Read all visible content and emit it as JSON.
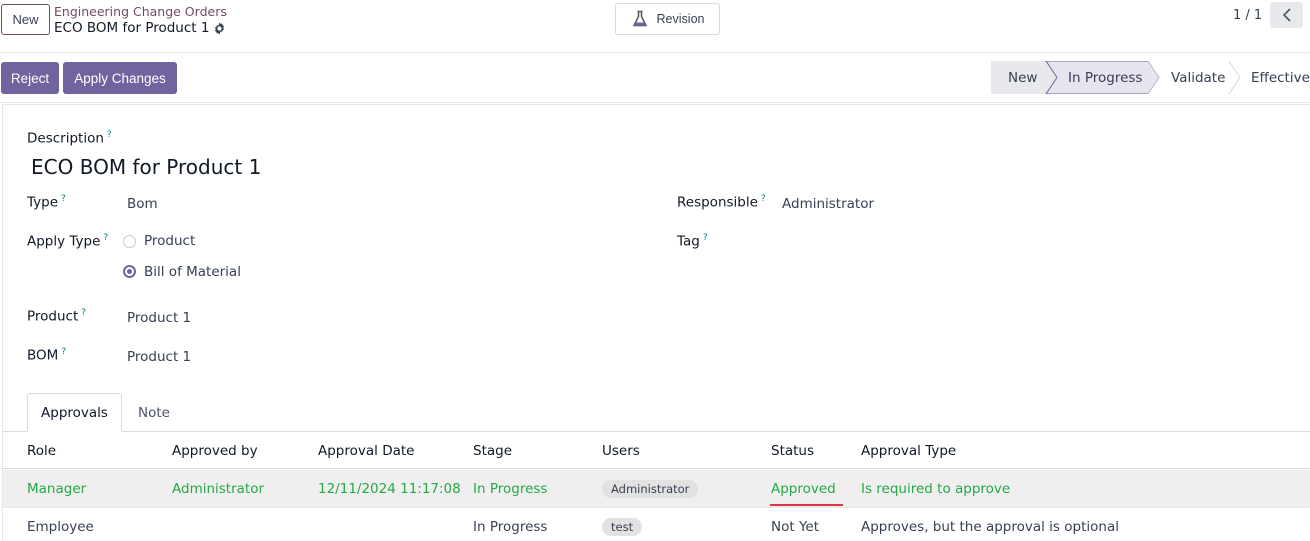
{
  "control": {
    "new_label": "New",
    "breadcrumb": "Engineering Change Orders",
    "record_title": "ECO BOM for Product 1",
    "revision_label": "Revision",
    "pager": "1 / 1"
  },
  "actions": {
    "reject_label": "Reject",
    "apply_label": "Apply Changes"
  },
  "stages": [
    {
      "label": "New",
      "active": false
    },
    {
      "label": "In Progress",
      "active": true
    },
    {
      "label": "Validate",
      "active": false
    },
    {
      "label": "Effective",
      "active": false
    }
  ],
  "form": {
    "description_label": "Description",
    "description_value": "ECO BOM for Product 1",
    "type_label": "Type",
    "type_value": "Bom",
    "apply_type_label": "Apply Type",
    "apply_type_options": [
      "Product",
      "Bill of Material"
    ],
    "apply_type_selected": "Bill of Material",
    "product_label": "Product",
    "product_value": "Product 1",
    "bom_label": "BOM",
    "bom_value": "Product 1",
    "responsible_label": "Responsible",
    "responsible_value": "Administrator",
    "tag_label": "Tag",
    "help_mark": "?"
  },
  "tabs": [
    {
      "label": "Approvals",
      "active": true
    },
    {
      "label": "Note",
      "active": false
    }
  ],
  "approvals": {
    "columns": [
      "Role",
      "Approved by",
      "Approval Date",
      "Stage",
      "Users",
      "Status",
      "Approval Type"
    ],
    "rows": [
      {
        "role": "Manager",
        "approved_by": "Administrator",
        "date": "12/11/2024 11:17:08",
        "stage": "In Progress",
        "users": "Administrator",
        "status": "Approved",
        "approval_type": "Is required to approve"
      },
      {
        "role": "Employee",
        "approved_by": "",
        "date": "",
        "stage": "In Progress",
        "users": "test",
        "status": "Not Yet",
        "approval_type": "Approves, but the approval is optional"
      }
    ]
  },
  "colors": {
    "primary": "#71639e",
    "brand": "#714b67",
    "approved_green": "#28a745",
    "help_teal": "#017e84",
    "status_underline": "#dc3545"
  }
}
